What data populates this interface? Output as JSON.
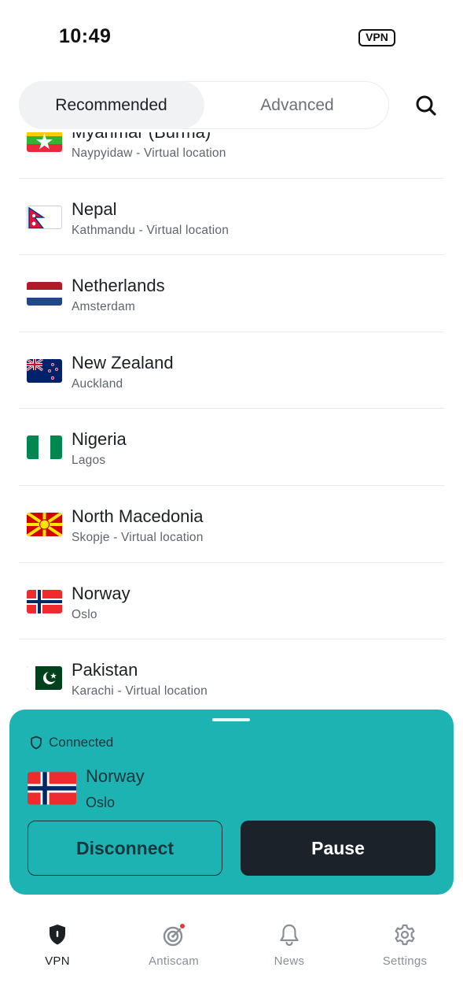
{
  "status_bar": {
    "time": "10:49",
    "vpn_badge": "VPN"
  },
  "tabs": {
    "recommended": "Recommended",
    "advanced": "Advanced"
  },
  "icons": {
    "search": "search-icon"
  },
  "locations": [
    {
      "country": "Myanmar (Burma)",
      "city": "Naypyidaw - Virtual location",
      "flag": "myanmar"
    },
    {
      "country": "Nepal",
      "city": "Kathmandu - Virtual location",
      "flag": "nepal"
    },
    {
      "country": "Netherlands",
      "city": "Amsterdam",
      "flag": "netherlands"
    },
    {
      "country": "New Zealand",
      "city": "Auckland",
      "flag": "new-zealand"
    },
    {
      "country": "Nigeria",
      "city": "Lagos",
      "flag": "nigeria"
    },
    {
      "country": "North Macedonia",
      "city": "Skopje - Virtual location",
      "flag": "north-macedonia"
    },
    {
      "country": "Norway",
      "city": "Oslo",
      "flag": "norway"
    },
    {
      "country": "Pakistan",
      "city": "Karachi - Virtual location",
      "flag": "pakistan"
    }
  ],
  "connection": {
    "status": "Connected",
    "country": "Norway",
    "city": "Oslo",
    "disconnect_label": "Disconnect",
    "pause_label": "Pause"
  },
  "nav": [
    {
      "label": "VPN",
      "icon": "vpn-shield-icon",
      "active": true
    },
    {
      "label": "Antiscam",
      "icon": "antiscam-radar-icon",
      "active": false,
      "badge": true
    },
    {
      "label": "News",
      "icon": "bell-icon",
      "active": false
    },
    {
      "label": "Settings",
      "icon": "gear-icon",
      "active": false
    }
  ],
  "colors": {
    "accent": "#1eb3b3",
    "dark_button": "#1c2229",
    "badge_dot": "#e03a3e"
  }
}
